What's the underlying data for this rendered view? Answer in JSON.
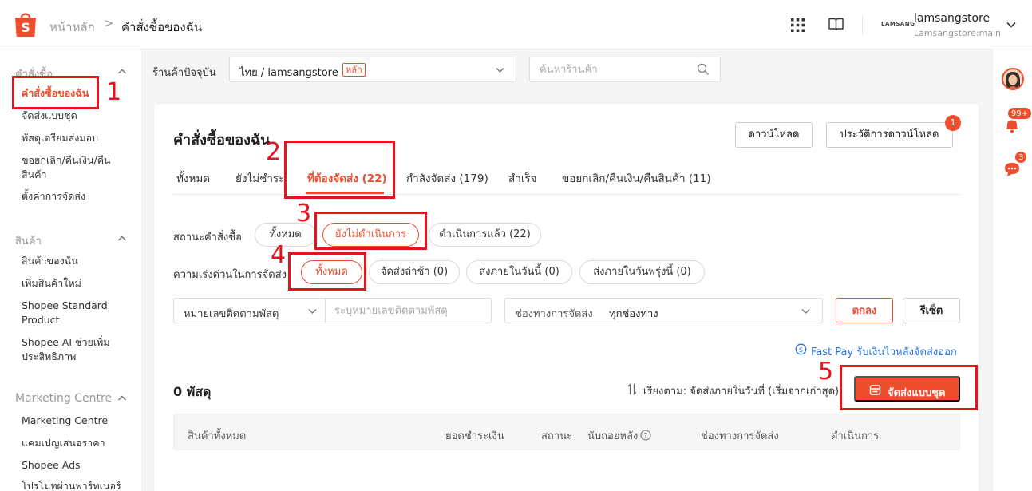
{
  "header": {
    "breadcrumb_home": "หน้าหลัก",
    "breadcrumb_sep": ">",
    "breadcrumb_current": "คำสั่งซื้อของฉัน",
    "store_logo_text": "LAMSANG",
    "store_name": "lamsangstore",
    "store_account": "Lamsangstore:main"
  },
  "sidebar": {
    "sections": [
      {
        "title": "คำสั่งซื้อ",
        "items": [
          "คำสั่งซื้อของฉัน",
          "จัดส่งแบบชุด",
          "พัสดุเตรียมส่งมอบ",
          "ขอยกเลิก/คืนเงิน/คืนสินค้า",
          "ตั้งค่าการจัดส่ง"
        ]
      },
      {
        "title": "สินค้า",
        "items": [
          "สินค้าของฉัน",
          "เพิ่มสินค้าใหม่",
          "Shopee Standard Product",
          "Shopee AI ช่วยเพิ่มประสิทธิภาพ"
        ]
      },
      {
        "title": "Marketing Centre",
        "items": [
          "Marketing Centre",
          "แคมเปญเสนอราคา",
          "Shopee Ads",
          "โปรโมทผ่านพาร์ทเนอร์"
        ]
      }
    ]
  },
  "shop_filter": {
    "label": "ร้านค้าปัจจุบัน",
    "value": "ไทย / lamsangstore",
    "tag": "หลัก",
    "search_placeholder": "ค้นหาร้านค้า"
  },
  "main": {
    "title": "คำสั่งซื้อของฉัน",
    "download_label": "ดาวน์โหลด",
    "history_label": "ประวัติการดาวน์โหลด",
    "history_badge": "1",
    "tabs": [
      "ทั้งหมด",
      "ยังไม่ชำระ",
      "ที่ต้องจัดส่ง (22)",
      "กำลังจัดส่ง (179)",
      "สำเร็จ",
      "ขอยกเลิก/คืนเงิน/คืนสินค้า (11)"
    ],
    "status_label": "สถานะคำสั่งซื้อ",
    "status_options": [
      "ทั้งหมด",
      "ยังไม่ดำเนินการ",
      "ดำเนินการแล้ว (22)"
    ],
    "urgency_label": "ความเร่งด่วนในการจัดส่ง",
    "urgency_options": [
      "ทั้งหมด",
      "จัดส่งล่าช้า (0)",
      "ส่งภายในวันนี้ (0)",
      "ส่งภายในวันพรุ่งนี้ (0)"
    ],
    "search_type": "หมายเลขติดตามพัสดุ",
    "search_placeholder": "ระบุหมายเลขติดตามพัสดุ",
    "channel_label": "ช่องทางการจัดส่ง",
    "channel_value": "ทุกช่องทาง",
    "ok_label": "ตกลง",
    "reset_label": "รีเซ็ต",
    "fastpay_text": "Fast Pay รับเงินไวหลังจัดส่งออก",
    "count_text": "0 พัสดุ",
    "sort_text": "เรียงตาม: จัดส่งภายในวันที่ (เริ่มจากเก่าสุด)",
    "mass_ship_label": "จัดส่งแบบชุด",
    "table_headers": [
      "สินค้าทั้งหมด",
      "ยอดชำระเงิน",
      "สถานะ",
      "นับถอยหลัง",
      "ช่องทางการจัดส่ง",
      "ดำเนินการ"
    ]
  },
  "rightbar": {
    "notif_badge": "99+",
    "chat_badge": "3"
  },
  "annotations": [
    "1",
    "2",
    "3",
    "4",
    "5"
  ],
  "colors": {
    "brand": "#ee4d2d",
    "link": "#2673dd",
    "annotation": "#e2141c"
  }
}
